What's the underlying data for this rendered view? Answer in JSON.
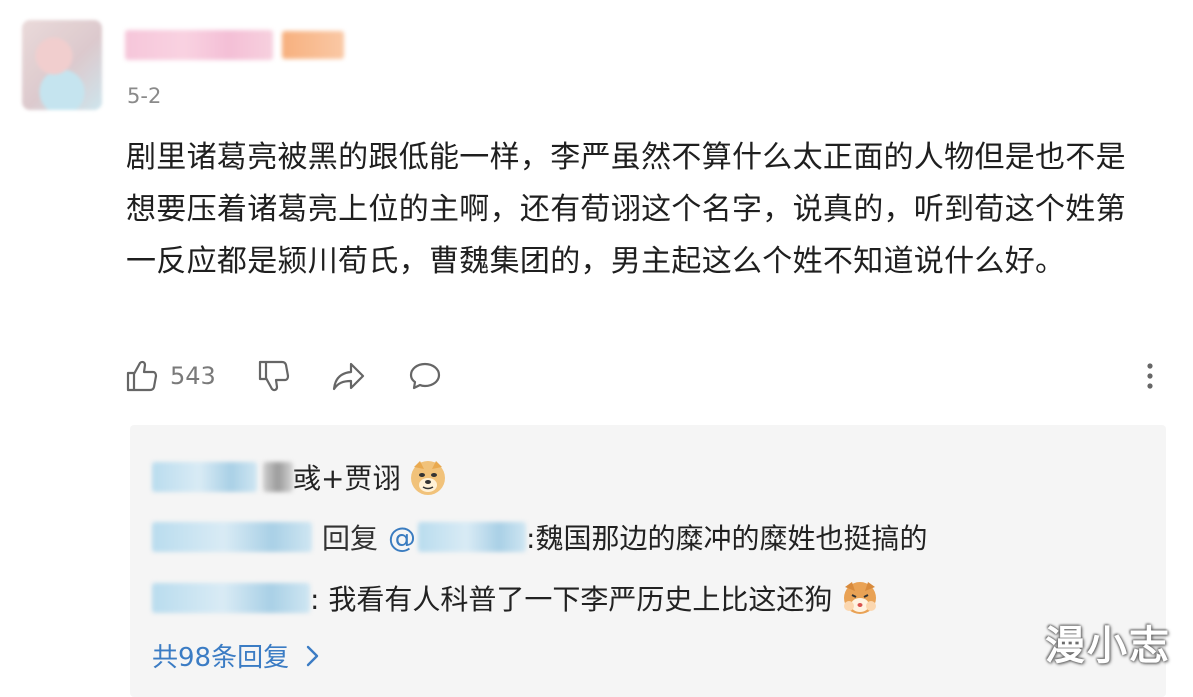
{
  "comment": {
    "date": "5-2",
    "text": "剧里诸葛亮被黑的跟低能一样，李严虽然不算什么太正面的人物但是也不是想要压着诸葛亮上位的主啊，还有荀诩这个名字，说真的，听到荀这个姓第一反应都是颍川荀氏，曹魏集团的，男主起这么个姓不知道说什么好。",
    "like_count": "543",
    "icons": [
      "thumbs-up-icon",
      "thumbs-down-icon",
      "share-icon",
      "comment-icon",
      "more-vert-icon"
    ]
  },
  "replies": {
    "items": [
      {
        "text": "彧+贾诩",
        "emoji": "doge-face"
      },
      {
        "prefix": "回复",
        "mention": "@",
        "text": ":魏国那边的糜冲的糜姓也挺搞的"
      },
      {
        "text": ": 我看有人科普了一下李严历史上比这还狗",
        "emoji": "shiba-cover-face"
      }
    ],
    "more_label": "共98条回复"
  },
  "watermark": "漫小志",
  "colors": {
    "link": "#3b7cc4",
    "reply_bg": "#f5f5f5",
    "meta": "#8a8a8a"
  }
}
